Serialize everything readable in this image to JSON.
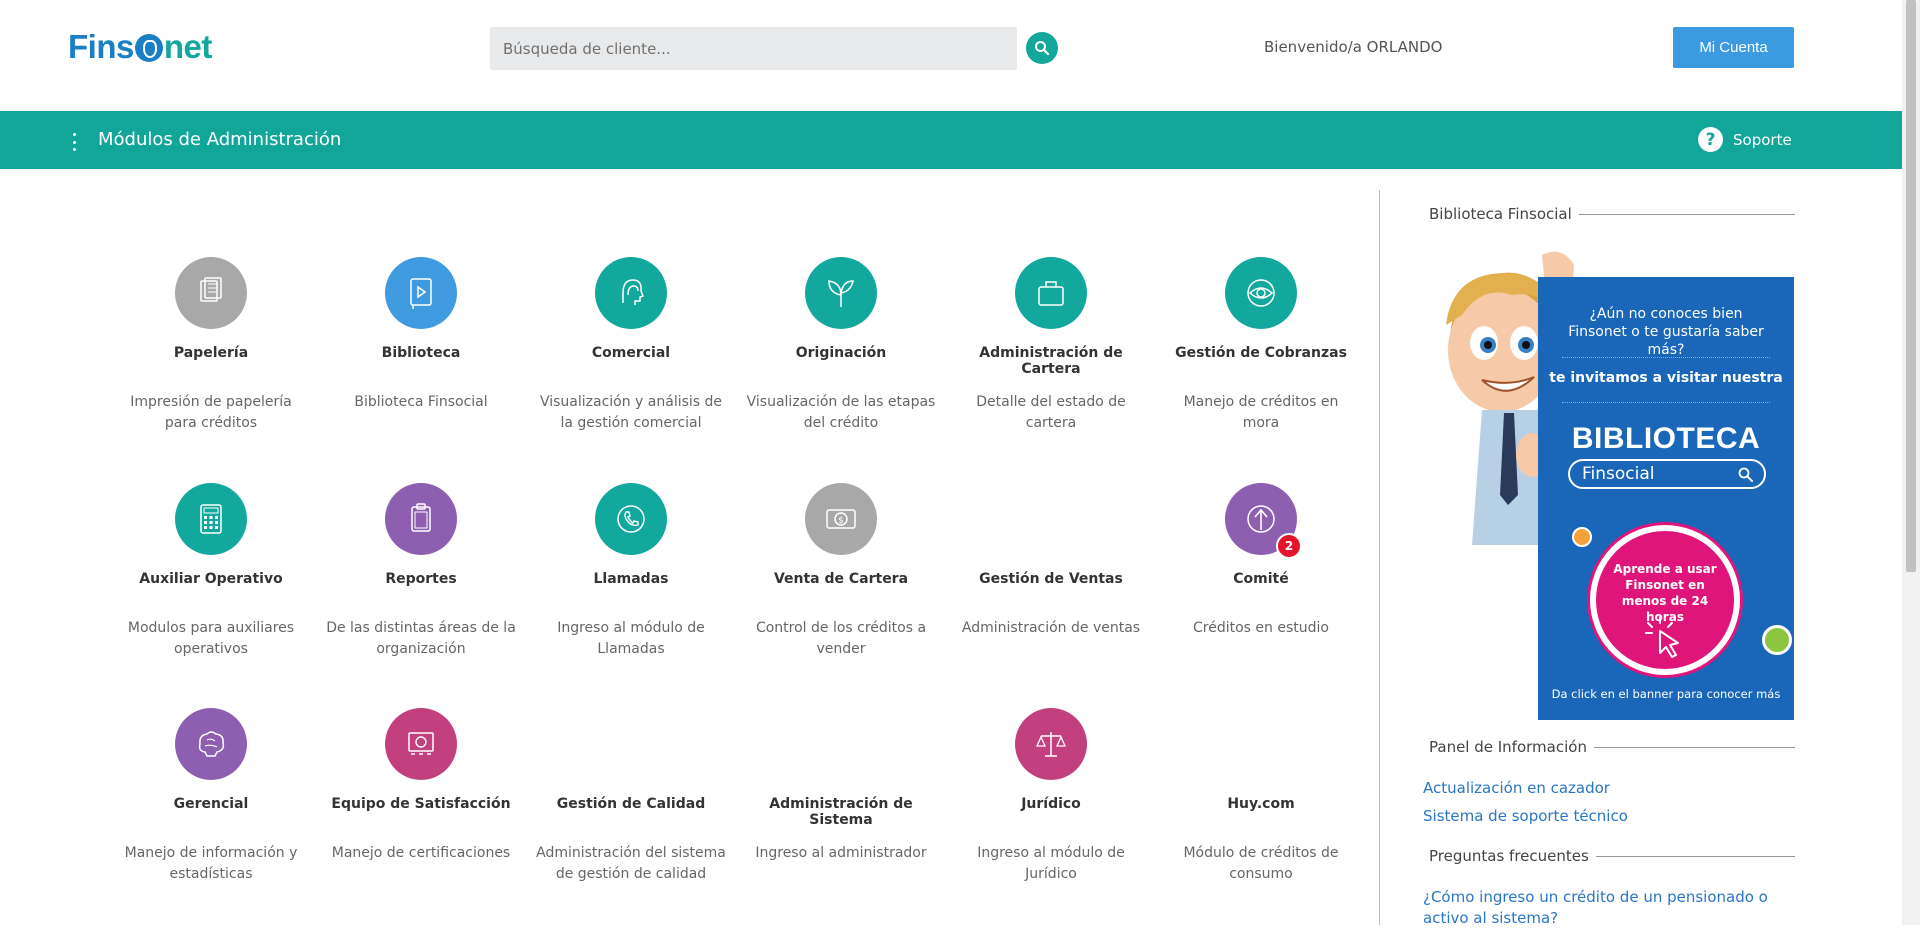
{
  "header": {
    "logo_left": "Fins",
    "logo_right": "net",
    "search_placeholder": "Búsqueda de cliente...",
    "welcome": "Bienvenido/a ORLANDO",
    "account_button": "Mi Cuenta"
  },
  "bar": {
    "title": "Módulos de Administración",
    "support": "Soporte",
    "support_icon": "?"
  },
  "modules": [
    {
      "title": "Papelería",
      "desc": "Impresión de papelería para créditos",
      "color": "#a8a8a8",
      "icon": "document-icon"
    },
    {
      "title": "Biblioteca",
      "desc": "Biblioteca Finsocial",
      "color": "#3f9ae0",
      "icon": "video-book-icon"
    },
    {
      "title": "Comercial",
      "desc": "Visualización y análisis de la gestión comercial",
      "color": "#12a89d",
      "icon": "head-icon"
    },
    {
      "title": "Originación",
      "desc": "Visualización de las etapas del crédito",
      "color": "#12a89d",
      "icon": "plant-icon"
    },
    {
      "title": "Administración de Cartera",
      "desc": "Detalle del estado de cartera",
      "color": "#12a89d",
      "icon": "briefcase-icon"
    },
    {
      "title": "Gestión de Cobranzas",
      "desc": "Manejo de créditos en mora",
      "color": "#12a89d",
      "icon": "eye-icon"
    },
    {
      "title": "Auxiliar Operativo",
      "desc": "Modulos para auxiliares operativos",
      "color": "#12a89d",
      "icon": "calculator-icon"
    },
    {
      "title": "Reportes",
      "desc": "De las distintas áreas de la organización",
      "color": "#8e5fb0",
      "icon": "clipboard-icon"
    },
    {
      "title": "Llamadas",
      "desc": "Ingreso al módulo de Llamadas",
      "color": "#12a89d",
      "icon": "phone-icon"
    },
    {
      "title": "Venta de Cartera",
      "desc": "Control de los créditos a vender",
      "color": "#a8a8a8",
      "icon": "money-icon"
    },
    {
      "title": "Gestión de Ventas",
      "desc": "Administración de ventas",
      "color": "",
      "icon": ""
    },
    {
      "title": "Comité",
      "desc": "Créditos en estudio",
      "color": "#8e5fb0",
      "icon": "upload-arrow-icon",
      "badge": "2"
    },
    {
      "title": "Gerencial",
      "desc": "Manejo de información y estadísticas",
      "color": "#8e5fb0",
      "icon": "brain-icon"
    },
    {
      "title": "Equipo de Satisfacción",
      "desc": "Manejo de certificaciones",
      "color": "#c2407e",
      "icon": "certificate-icon"
    },
    {
      "title": "Gestión de Calidad",
      "desc": "Administración del sistema de gestión de calidad",
      "color": "",
      "icon": ""
    },
    {
      "title": "Administración de Sistema",
      "desc": "Ingreso al administrador",
      "color": "",
      "icon": ""
    },
    {
      "title": "Jurídico",
      "desc": "Ingreso al módulo de Jurídico",
      "color": "#c2407e",
      "icon": "scales-icon"
    },
    {
      "title": "Huy.com",
      "desc": "Módulo de créditos de consumo",
      "color": "",
      "icon": ""
    }
  ],
  "sidebar": {
    "library_heading": "Biblioteca Finsocial",
    "banner": {
      "question": "¿Aún no conoces bien Finsonet o te gustaría saber más?",
      "invite": "te invitamos a visitar nuestra",
      "big": "BIBLIOTECA",
      "pill": "Finsocial",
      "circle_text": "Aprende a usar Finsonet en menos de 24 horas",
      "footer": "Da click en el banner para conocer más"
    },
    "info_heading": "Panel de Información",
    "info_links": [
      "Actualización en cazador",
      "Sistema de soporte técnico"
    ],
    "faq_heading": "Preguntas frecuentes",
    "faq_links": [
      "¿Cómo ingreso un crédito de un pensionado o activo al sistema?"
    ]
  }
}
